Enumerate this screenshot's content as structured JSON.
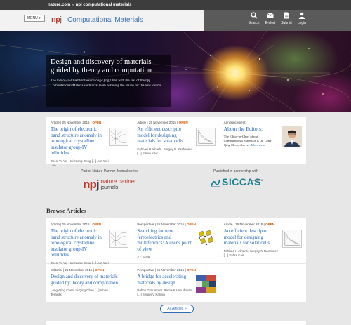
{
  "breadcrumb": {
    "site": "nature.com",
    "journal": "npj computational materials"
  },
  "header": {
    "menu_label": "MENU ▾",
    "npj_mark": "np",
    "npj_mark_j": "j",
    "journal_title": "Computational Materials",
    "tools": [
      {
        "icon": "search-icon",
        "label": "Search"
      },
      {
        "icon": "email-icon",
        "label": "E-alert"
      },
      {
        "icon": "document-icon",
        "label": "Submit"
      },
      {
        "icon": "user-icon",
        "label": "Login"
      }
    ]
  },
  "hero": {
    "title": "Design and discovery of materials guided by theory and computation",
    "description": "The Editor-in-Chief Professor Long-Qing Chen with the rest of the npj Computational Materials editorial team outlining the vision for the new journal."
  },
  "featured": [
    {
      "type": "Article",
      "date": "25 November 2015",
      "open": "OPEN",
      "title": "The origin of electronic band structure anomaly in topological crystalline insulator group-IV tellurides",
      "authors": "Zhen-Yu Ye, Hui-Xiong Deng [...] Jun-Wei Luo"
    },
    {
      "type": "Article",
      "date": "25 November 2015",
      "open": "OPEN",
      "title": "An efficient descriptor model for designing materials for solar cells",
      "authors": "Fahhad H Alharbi, Sergey N Rashkeev [...] Sabre Kais"
    },
    {
      "type": "Announcement",
      "date": "",
      "open": "",
      "title": "About the Editors:",
      "body": "The Editor-in-Chief of npj Computational Materials is Dr. Long-Qing Chen, who is...",
      "more": "More more"
    }
  ],
  "partners": {
    "left_label": "Part of Nature Partner Journal series",
    "npj_big": "np",
    "npj_big_j": "j",
    "nature_word": "nature",
    "partner_word": "partner",
    "journals_word": "journals",
    "right_label": "Published in partnership with",
    "siccas": "SICCAS",
    "since": "Since 1928"
  },
  "browse": {
    "title": "Browse Articles",
    "row1": [
      {
        "type": "Article",
        "date": "25 November 2015",
        "open": "OPEN",
        "title": "The origin of electronic band structure anomaly in topological crystalline insulator group-IV tellurides",
        "authors": "Zhen-Yu Ye, Hui-Xiong Deng [...] Jun-Wei Luo"
      },
      {
        "type": "Perspective",
        "date": "25 November 2015",
        "open": "OPEN",
        "title": "Searching for new ferroelectrics and multiferroics: A user's point of view",
        "authors": "J F Scott"
      },
      {
        "type": "Article",
        "date": "25 November 2015",
        "open": "OPEN",
        "title": "An efficient descriptor model for designing materials for solar cells",
        "authors": "Fahhad H Alharbi, Sergey N Rashkeev [...] Sabre Kais"
      }
    ],
    "row2": [
      {
        "type": "Editorial",
        "date": "25 November 2015",
        "open": "OPEN",
        "title": "Design and discovery of materials guided by theory and computation",
        "authors": "Long-Qing Chen, Li-Qing Chen [...] Ichiro Terasaki"
      },
      {
        "type": "Perspective",
        "date": "25 November 2015",
        "open": "OPEN",
        "title": "A bridge for accelerating materials by design",
        "authors": "Bobby G Sumpter, Rama K Vasudevan [...] Sergei V Kalinin"
      }
    ],
    "all_label": "All Articles »"
  }
}
